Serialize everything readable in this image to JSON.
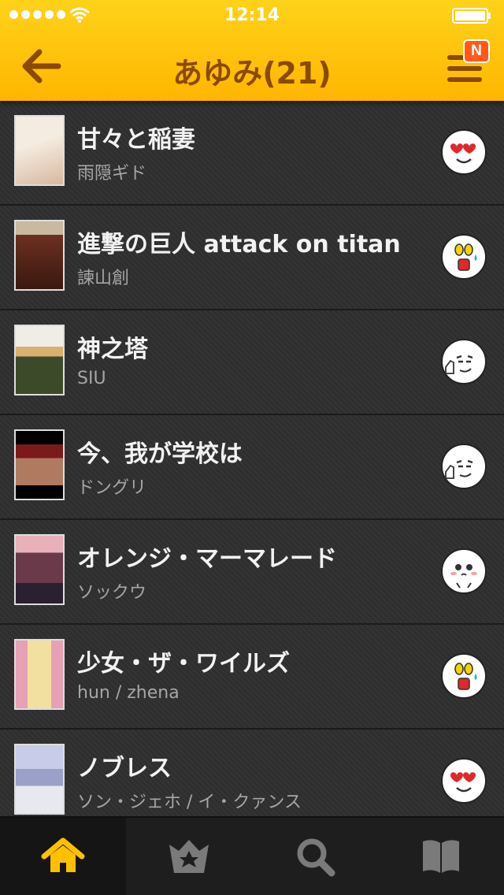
{
  "status_bar": {
    "time": "12:14"
  },
  "header": {
    "title": "あゆみ(21)",
    "menu_badge": "N"
  },
  "list": [
    {
      "title": "甘々と稲妻",
      "author": "雨隠ギド",
      "thumb_color": "#e9d9c8",
      "reaction_icon": "heart-eyes-icon"
    },
    {
      "title": "進撃の巨人 attack on titan",
      "author": "諫山創",
      "thumb_color": "#6b3020",
      "reaction_icon": "shocked-icon"
    },
    {
      "title": "神之塔",
      "author": "SIU",
      "thumb_color": "#3d4a2a",
      "reaction_icon": "thumbs-up-icon"
    },
    {
      "title": "今、我が学校は",
      "author": "ドングリ",
      "thumb_color": "#7a1a1a",
      "reaction_icon": "thumbs-up-icon"
    },
    {
      "title": "オレンジ・マーマレード",
      "author": "ソックウ",
      "thumb_color": "#8a5a6a",
      "reaction_icon": "pleading-icon"
    },
    {
      "title": "少女・ザ・ワイルズ",
      "author": "hun / zhena",
      "thumb_color": "#e8a0b4",
      "reaction_icon": "shocked-icon"
    },
    {
      "title": "ノブレス",
      "author": "ソン・ジェホ / イ・クァンス",
      "thumb_color": "#9aa0c8",
      "reaction_icon": "heart-eyes-icon"
    }
  ],
  "tabbar": {
    "tabs": [
      {
        "icon": "home-icon",
        "active": true
      },
      {
        "icon": "star-crown-icon",
        "active": false
      },
      {
        "icon": "search-icon",
        "active": false
      },
      {
        "icon": "book-icon",
        "active": false
      }
    ]
  },
  "colors": {
    "accent": "#ffc20e",
    "title_text": "#8a4a00",
    "active_tab": "#ffc000",
    "inactive_tab": "#7a7a7a"
  }
}
